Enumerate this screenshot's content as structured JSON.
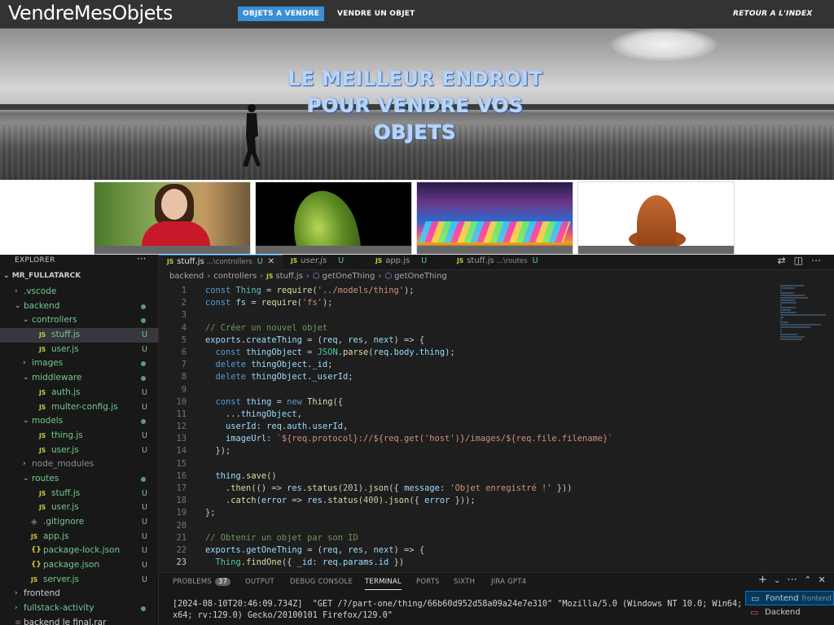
{
  "site": {
    "logo": "VendreMesObjets",
    "nav": [
      {
        "label": "OBJETS A VENDRE",
        "active": true
      },
      {
        "label": "VENDRE UN OBJET",
        "active": false
      },
      {
        "label": "RETOUR A L'INDEX",
        "active": false
      }
    ],
    "hero_lines": [
      "LE MEILLEUR ENDROIT",
      "POUR VENDRE VOS",
      "OBJETS"
    ],
    "accent": "#3a8fd6"
  },
  "explorer": {
    "title": "EXPLORER",
    "root": "MR_FULLATARCK",
    "items": [
      {
        "label": ".vscode",
        "kind": "folder",
        "depth": 1,
        "expanded": false,
        "status": ""
      },
      {
        "label": "backend",
        "kind": "folder",
        "depth": 1,
        "expanded": true,
        "status": "dot"
      },
      {
        "label": "controllers",
        "kind": "folder",
        "depth": 2,
        "expanded": true,
        "status": "dot"
      },
      {
        "label": "stuff.js",
        "kind": "js",
        "depth": 3,
        "status": "U",
        "selected": true
      },
      {
        "label": "user.js",
        "kind": "js",
        "depth": 3,
        "status": "U"
      },
      {
        "label": "images",
        "kind": "folder",
        "depth": 2,
        "expanded": false,
        "status": "dot"
      },
      {
        "label": "middleware",
        "kind": "folder",
        "depth": 2,
        "expanded": true,
        "status": "dot"
      },
      {
        "label": "auth.js",
        "kind": "js",
        "depth": 3,
        "status": "U"
      },
      {
        "label": "multer-config.js",
        "kind": "js",
        "depth": 3,
        "status": "U"
      },
      {
        "label": "models",
        "kind": "folder",
        "depth": 2,
        "expanded": true,
        "status": "dot"
      },
      {
        "label": "thing.js",
        "kind": "js",
        "depth": 3,
        "status": "U"
      },
      {
        "label": "user.js",
        "kind": "js",
        "depth": 3,
        "status": "U"
      },
      {
        "label": "node_modules",
        "kind": "folder-dim",
        "depth": 2,
        "expanded": false,
        "status": ""
      },
      {
        "label": "routes",
        "kind": "folder",
        "depth": 2,
        "expanded": true,
        "status": "dot"
      },
      {
        "label": "stuff.js",
        "kind": "js",
        "depth": 3,
        "status": "U"
      },
      {
        "label": "user.js",
        "kind": "js",
        "depth": 3,
        "status": "U"
      },
      {
        "label": ".gitignore",
        "kind": "git",
        "depth": 2,
        "status": "U"
      },
      {
        "label": "app.js",
        "kind": "js",
        "depth": 2,
        "status": "U"
      },
      {
        "label": "package-lock.json",
        "kind": "json",
        "depth": 2,
        "status": "U"
      },
      {
        "label": "package.json",
        "kind": "json",
        "depth": 2,
        "status": "U"
      },
      {
        "label": "server.js",
        "kind": "js",
        "depth": 2,
        "status": "U"
      },
      {
        "label": "frontend",
        "kind": "folder-plain",
        "depth": 1,
        "expanded": false,
        "status": ""
      },
      {
        "label": "fullstack-activity",
        "kind": "folder",
        "depth": 1,
        "expanded": false,
        "status": "dot"
      },
      {
        "label": "backend le final.rar",
        "kind": "file-plain",
        "depth": 1,
        "status": ""
      }
    ]
  },
  "tabs": [
    {
      "name": "stuff.js",
      "path": "...\\controllers",
      "status": "U",
      "active": true,
      "italic": false
    },
    {
      "name": "user.js",
      "path": "",
      "status": "U",
      "active": false,
      "italic": true
    },
    {
      "name": "app.js",
      "path": "",
      "status": "U",
      "active": false,
      "italic": false
    },
    {
      "name": "stuff.js",
      "path": "...\\routes",
      "status": "U",
      "active": false,
      "italic": false
    }
  ],
  "breadcrumb": [
    "backend",
    "controllers",
    "stuff.js",
    "getOneThing",
    "getOneThing"
  ],
  "code": {
    "current_line": 23,
    "lines": [
      {
        "n": "1",
        "t": "const Thing = require('../models/thing');"
      },
      {
        "n": "2",
        "t": "const fs = require('fs');"
      },
      {
        "n": "3",
        "t": ""
      },
      {
        "n": "4",
        "t": "// Créer un nouvel objet"
      },
      {
        "n": "5",
        "t": "exports.createThing = (req, res, next) => {"
      },
      {
        "n": "6",
        "t": "  const thingObject = JSON.parse(req.body.thing);"
      },
      {
        "n": "7",
        "t": "  delete thingObject._id;"
      },
      {
        "n": "8",
        "t": "  delete thingObject._userId;"
      },
      {
        "n": "9",
        "t": ""
      },
      {
        "n": "10",
        "t": "  const thing = new Thing({"
      },
      {
        "n": "11",
        "t": "    ...thingObject,"
      },
      {
        "n": "12",
        "t": "    userId: req.auth.userId,"
      },
      {
        "n": "13",
        "t": "    imageUrl: `${req.protocol}://${req.get('host')}/images/${req.file.filename}`"
      },
      {
        "n": "14",
        "t": "  });"
      },
      {
        "n": "15",
        "t": ""
      },
      {
        "n": "16",
        "t": "  thing.save()"
      },
      {
        "n": "17",
        "t": "    .then(() => res.status(201).json({ message: 'Objet enregistré !' }))"
      },
      {
        "n": "18",
        "t": "    .catch(error => res.status(400).json({ error }));"
      },
      {
        "n": "19",
        "t": "};"
      },
      {
        "n": "20",
        "t": ""
      },
      {
        "n": "21",
        "t": "// Obtenir un objet par son ID"
      },
      {
        "n": "22",
        "t": "exports.getOneThing = (req, res, next) => {"
      },
      {
        "n": "23",
        "t": "  Thing.findOne({ _id: req.params.id })"
      }
    ]
  },
  "panel": {
    "tabs": [
      {
        "label": "PROBLEMS",
        "badge": "37"
      },
      {
        "label": "OUTPUT",
        "badge": ""
      },
      {
        "label": "DEBUG CONSOLE",
        "badge": ""
      },
      {
        "label": "TERMINAL",
        "badge": "",
        "active": true
      },
      {
        "label": "PORTS",
        "badge": ""
      },
      {
        "label": "SIXTH",
        "badge": ""
      },
      {
        "label": "JIRA GPT4",
        "badge": ""
      }
    ],
    "terminal_output": "[2024-08-10T20:46:09.734Z]  \"GET /?/part-one/thing/66b60d952d58a09a24e7e310\" \"Mozilla/5.0 (Windows NT 10.0; Win64; x64; rv:129.0) Gecko/20100101 Firefox/129.0\"",
    "terminals": [
      {
        "name": "Fontend",
        "sub": "frontend",
        "active": true
      },
      {
        "name": "Dackend",
        "sub": "",
        "active": false
      }
    ]
  }
}
